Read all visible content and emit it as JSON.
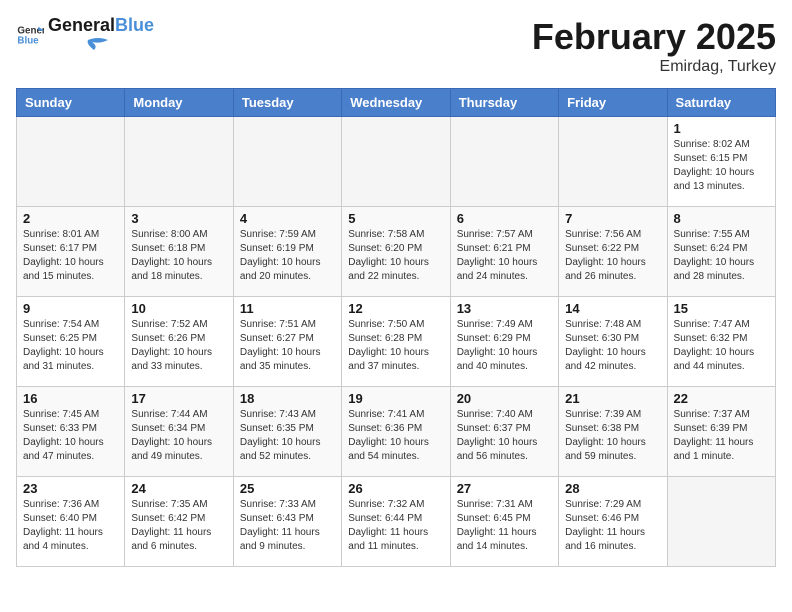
{
  "header": {
    "logo_line1": "General",
    "logo_line2": "Blue",
    "month_title": "February 2025",
    "subtitle": "Emirdag, Turkey"
  },
  "days_of_week": [
    "Sunday",
    "Monday",
    "Tuesday",
    "Wednesday",
    "Thursday",
    "Friday",
    "Saturday"
  ],
  "weeks": [
    [
      {
        "num": "",
        "info": ""
      },
      {
        "num": "",
        "info": ""
      },
      {
        "num": "",
        "info": ""
      },
      {
        "num": "",
        "info": ""
      },
      {
        "num": "",
        "info": ""
      },
      {
        "num": "",
        "info": ""
      },
      {
        "num": "1",
        "info": "Sunrise: 8:02 AM\nSunset: 6:15 PM\nDaylight: 10 hours\nand 13 minutes."
      }
    ],
    [
      {
        "num": "2",
        "info": "Sunrise: 8:01 AM\nSunset: 6:17 PM\nDaylight: 10 hours\nand 15 minutes."
      },
      {
        "num": "3",
        "info": "Sunrise: 8:00 AM\nSunset: 6:18 PM\nDaylight: 10 hours\nand 18 minutes."
      },
      {
        "num": "4",
        "info": "Sunrise: 7:59 AM\nSunset: 6:19 PM\nDaylight: 10 hours\nand 20 minutes."
      },
      {
        "num": "5",
        "info": "Sunrise: 7:58 AM\nSunset: 6:20 PM\nDaylight: 10 hours\nand 22 minutes."
      },
      {
        "num": "6",
        "info": "Sunrise: 7:57 AM\nSunset: 6:21 PM\nDaylight: 10 hours\nand 24 minutes."
      },
      {
        "num": "7",
        "info": "Sunrise: 7:56 AM\nSunset: 6:22 PM\nDaylight: 10 hours\nand 26 minutes."
      },
      {
        "num": "8",
        "info": "Sunrise: 7:55 AM\nSunset: 6:24 PM\nDaylight: 10 hours\nand 28 minutes."
      }
    ],
    [
      {
        "num": "9",
        "info": "Sunrise: 7:54 AM\nSunset: 6:25 PM\nDaylight: 10 hours\nand 31 minutes."
      },
      {
        "num": "10",
        "info": "Sunrise: 7:52 AM\nSunset: 6:26 PM\nDaylight: 10 hours\nand 33 minutes."
      },
      {
        "num": "11",
        "info": "Sunrise: 7:51 AM\nSunset: 6:27 PM\nDaylight: 10 hours\nand 35 minutes."
      },
      {
        "num": "12",
        "info": "Sunrise: 7:50 AM\nSunset: 6:28 PM\nDaylight: 10 hours\nand 37 minutes."
      },
      {
        "num": "13",
        "info": "Sunrise: 7:49 AM\nSunset: 6:29 PM\nDaylight: 10 hours\nand 40 minutes."
      },
      {
        "num": "14",
        "info": "Sunrise: 7:48 AM\nSunset: 6:30 PM\nDaylight: 10 hours\nand 42 minutes."
      },
      {
        "num": "15",
        "info": "Sunrise: 7:47 AM\nSunset: 6:32 PM\nDaylight: 10 hours\nand 44 minutes."
      }
    ],
    [
      {
        "num": "16",
        "info": "Sunrise: 7:45 AM\nSunset: 6:33 PM\nDaylight: 10 hours\nand 47 minutes."
      },
      {
        "num": "17",
        "info": "Sunrise: 7:44 AM\nSunset: 6:34 PM\nDaylight: 10 hours\nand 49 minutes."
      },
      {
        "num": "18",
        "info": "Sunrise: 7:43 AM\nSunset: 6:35 PM\nDaylight: 10 hours\nand 52 minutes."
      },
      {
        "num": "19",
        "info": "Sunrise: 7:41 AM\nSunset: 6:36 PM\nDaylight: 10 hours\nand 54 minutes."
      },
      {
        "num": "20",
        "info": "Sunrise: 7:40 AM\nSunset: 6:37 PM\nDaylight: 10 hours\nand 56 minutes."
      },
      {
        "num": "21",
        "info": "Sunrise: 7:39 AM\nSunset: 6:38 PM\nDaylight: 10 hours\nand 59 minutes."
      },
      {
        "num": "22",
        "info": "Sunrise: 7:37 AM\nSunset: 6:39 PM\nDaylight: 11 hours\nand 1 minute."
      }
    ],
    [
      {
        "num": "23",
        "info": "Sunrise: 7:36 AM\nSunset: 6:40 PM\nDaylight: 11 hours\nand 4 minutes."
      },
      {
        "num": "24",
        "info": "Sunrise: 7:35 AM\nSunset: 6:42 PM\nDaylight: 11 hours\nand 6 minutes."
      },
      {
        "num": "25",
        "info": "Sunrise: 7:33 AM\nSunset: 6:43 PM\nDaylight: 11 hours\nand 9 minutes."
      },
      {
        "num": "26",
        "info": "Sunrise: 7:32 AM\nSunset: 6:44 PM\nDaylight: 11 hours\nand 11 minutes."
      },
      {
        "num": "27",
        "info": "Sunrise: 7:31 AM\nSunset: 6:45 PM\nDaylight: 11 hours\nand 14 minutes."
      },
      {
        "num": "28",
        "info": "Sunrise: 7:29 AM\nSunset: 6:46 PM\nDaylight: 11 hours\nand 16 minutes."
      },
      {
        "num": "",
        "info": ""
      }
    ]
  ]
}
